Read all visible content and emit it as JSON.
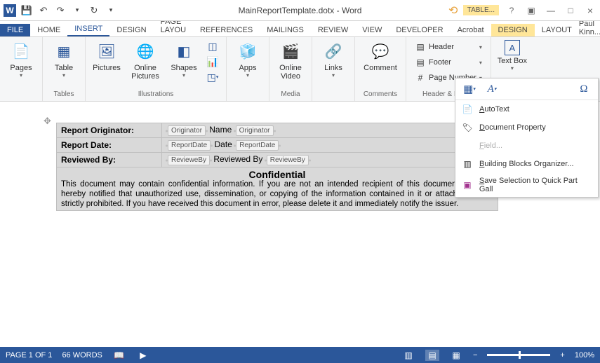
{
  "titlebar": {
    "doc_title": "MainReportTemplate.dotx - Word",
    "table_tools": "TABLE...",
    "user": "Paul Kinn..."
  },
  "tabs": {
    "file": "FILE",
    "home": "HOME",
    "insert": "INSERT",
    "design": "DESIGN",
    "pagelayout": "PAGE LAYOU",
    "references": "REFERENCES",
    "mailings": "MAILINGS",
    "review": "REVIEW",
    "view": "VIEW",
    "developer": "DEVELOPER",
    "acrobat": "Acrobat",
    "design2": "DESIGN",
    "layout": "LAYOUT"
  },
  "ribbon": {
    "pages": {
      "btn": "Pages"
    },
    "tables": {
      "group": "Tables",
      "btn": "Table"
    },
    "illustrations": {
      "group": "Illustrations",
      "pictures": "Pictures",
      "online_pictures": "Online Pictures",
      "shapes": "Shapes"
    },
    "apps": {
      "btn": "Apps"
    },
    "media": {
      "group": "Media",
      "online_video": "Online Video"
    },
    "links": {
      "btn": "Links"
    },
    "comments": {
      "group": "Comments",
      "comment": "Comment"
    },
    "header_footer": {
      "group": "Header & Footer",
      "header": "Header",
      "footer": "Footer",
      "page_number": "Page Number"
    },
    "text": {
      "text_box": "Text Box"
    }
  },
  "dropdown": {
    "autotext": "AutoText",
    "doc_prop": "Document Property",
    "field": "Field...",
    "bbo": "Building Blocks Organizer...",
    "save_sel": "Save Selection to Quick Part Gall"
  },
  "document": {
    "row1_label": "Report Originator:",
    "row1_tag": "Originator",
    "row1_text": "Name",
    "row2_label": "Report Date:",
    "row2_tag": "ReportDate",
    "row2_text": "Date",
    "row3_label": "Reviewed By:",
    "row3_tag": "RevieweBy",
    "row3_text": "Reviewed By",
    "confidential": "Confidential",
    "body": "This document may contain confidential information. If you are not an intended recipient of this document, you are hereby notified that unauthorized use, dissemination, or copying of the information contained in it or attached to it is strictly prohibited. If you have received this document in error, please delete it and immediately notify the issuer."
  },
  "statusbar": {
    "page": "PAGE 1 OF 1",
    "words": "66 WORDS",
    "zoom_minus": "−",
    "zoom_plus": "+",
    "zoom_pct": "100%"
  }
}
